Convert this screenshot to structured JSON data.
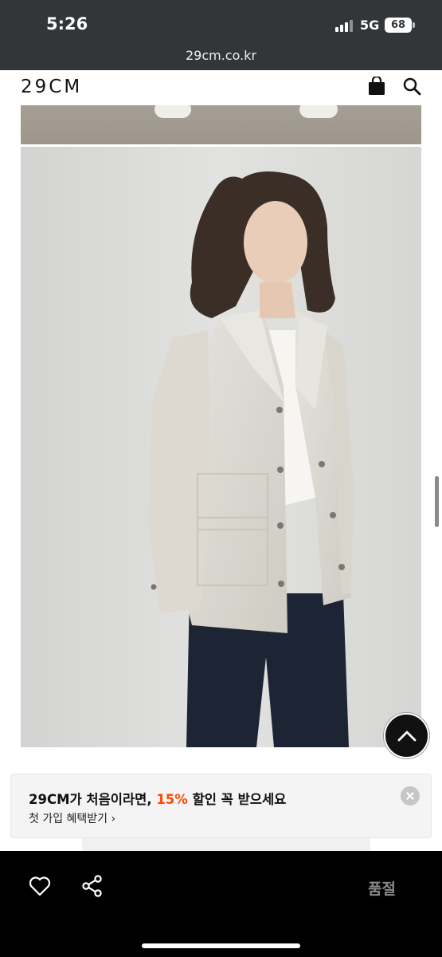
{
  "status_bar": {
    "time": "5:26",
    "network": "5G",
    "battery": "68"
  },
  "browser": {
    "url": "29cm.co.kr"
  },
  "header": {
    "logo": "29CM",
    "icons": [
      "shopping-bag-icon",
      "search-icon"
    ]
  },
  "promo": {
    "title_prefix": "29CM가 처음이라면, ",
    "discount": "15%",
    "title_suffix": " 할인 꼭 받으세요",
    "link": "첫 가입 혜택받기 ›"
  },
  "bottom_bar": {
    "status_label": "품절",
    "icons": [
      "heart-icon",
      "share-icon"
    ]
  },
  "colors": {
    "accent": "#ff4800",
    "chrome": "#333639",
    "bottom_bar": "#000000"
  }
}
